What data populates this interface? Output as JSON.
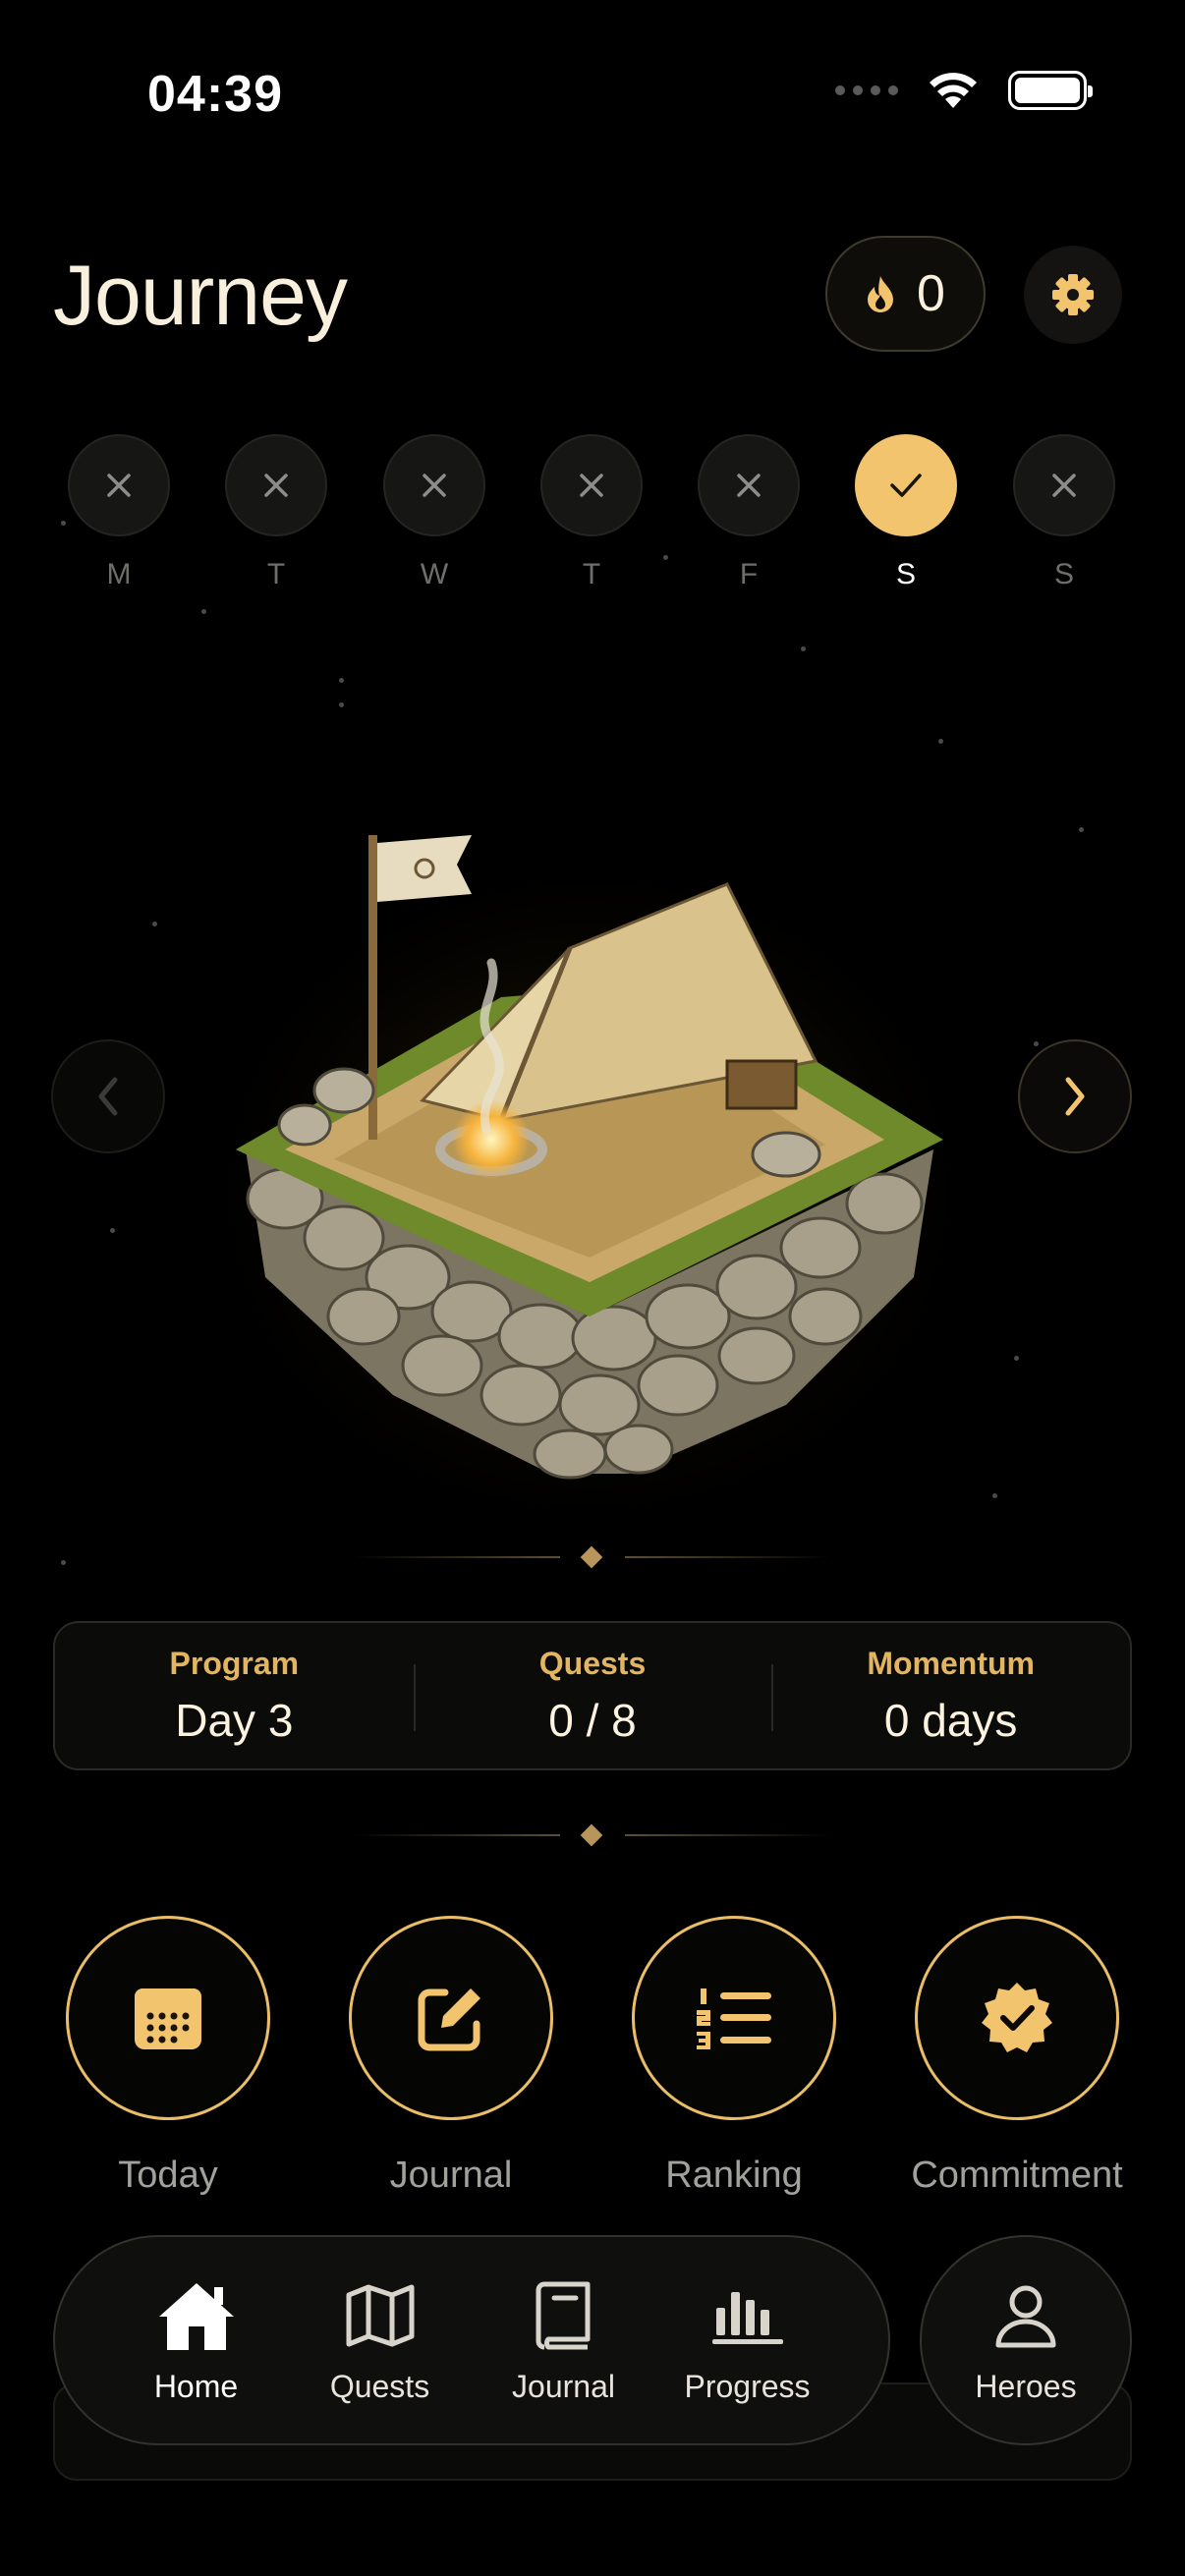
{
  "status_bar": {
    "time": "04:39"
  },
  "header": {
    "title": "Journey",
    "streak_count": "0"
  },
  "week": [
    {
      "letter": "M",
      "state": "missed"
    },
    {
      "letter": "T",
      "state": "missed"
    },
    {
      "letter": "W",
      "state": "missed"
    },
    {
      "letter": "T",
      "state": "missed"
    },
    {
      "letter": "F",
      "state": "missed"
    },
    {
      "letter": "S",
      "state": "done"
    },
    {
      "letter": "S",
      "state": "missed"
    }
  ],
  "stats": [
    {
      "label": "Program",
      "value": "Day 3"
    },
    {
      "label": "Quests",
      "value": "0 / 8"
    },
    {
      "label": "Momentum",
      "value": "0 days"
    }
  ],
  "actions": [
    {
      "label": "Today",
      "icon": "calendar-icon"
    },
    {
      "label": "Journal",
      "icon": "edit-icon"
    },
    {
      "label": "Ranking",
      "icon": "ranked-list-icon"
    },
    {
      "label": "Commitment",
      "icon": "verified-badge-icon"
    }
  ],
  "tabs": [
    {
      "label": "Home",
      "icon": "home-icon",
      "active": true
    },
    {
      "label": "Quests",
      "icon": "map-icon",
      "active": false
    },
    {
      "label": "Journal",
      "icon": "book-icon",
      "active": false
    },
    {
      "label": "Progress",
      "icon": "bar-chart-icon",
      "active": false
    },
    {
      "label": "Heroes",
      "icon": "person-icon",
      "active": false
    }
  ],
  "colors": {
    "accent": "#f2c46e",
    "label_gold": "#e3b560",
    "background": "#000000"
  }
}
